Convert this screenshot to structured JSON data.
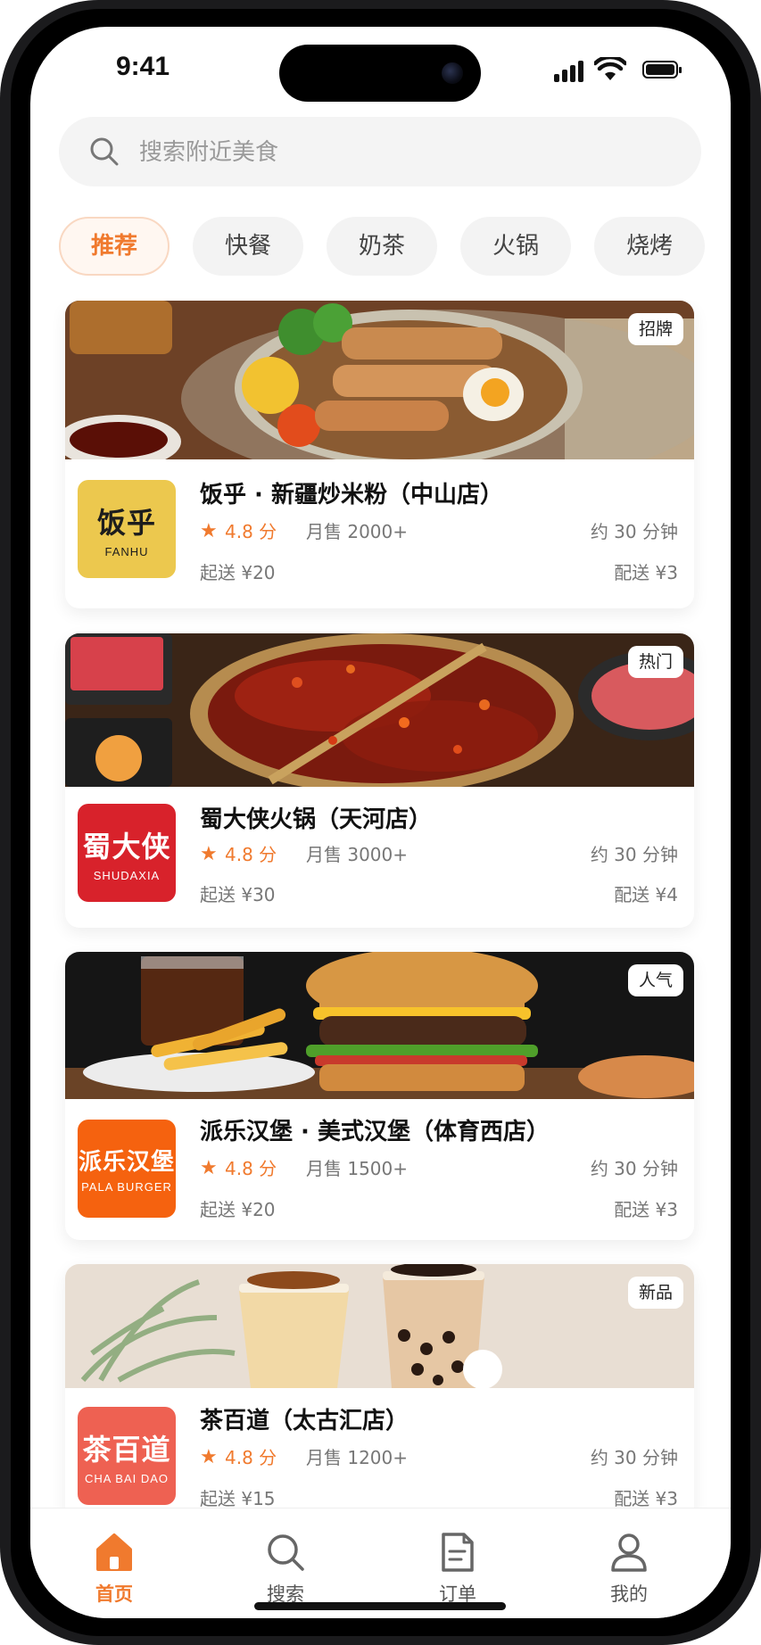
{
  "status": {
    "time": "9:41"
  },
  "search": {
    "placeholder": "搜索附近美食"
  },
  "categories": [
    {
      "label": "推荐",
      "active": true
    },
    {
      "label": "快餐"
    },
    {
      "label": "奶茶"
    },
    {
      "label": "火锅"
    },
    {
      "label": "烧烤"
    }
  ],
  "restaurants": [
    {
      "tag": "招牌",
      "logo_text": "饭乎",
      "logo_sub": "FANHU",
      "name": "饭乎 · 新疆炒米粉（中山店）",
      "rating": "4.8 分",
      "sales": "月售 2000+",
      "eta": "约 30 分钟",
      "min_order": "起送 ¥20",
      "delivery_fee": "配送 ¥3"
    },
    {
      "tag": "热门",
      "logo_text": "蜀大侠",
      "logo_sub": "SHUDAXIA",
      "name": "蜀大侠火锅（天河店）",
      "rating": "4.8 分",
      "sales": "月售 3000+",
      "eta": "约 30 分钟",
      "min_order": "起送 ¥30",
      "delivery_fee": "配送 ¥4"
    },
    {
      "tag": "人气",
      "logo_text": "派乐汉堡",
      "logo_sub": "PALA BURGER",
      "name": "派乐汉堡 · 美式汉堡（体育西店）",
      "rating": "4.8 分",
      "sales": "月售 1500+",
      "eta": "约 30 分钟",
      "min_order": "起送 ¥20",
      "delivery_fee": "配送 ¥3"
    },
    {
      "tag": "新品",
      "logo_text": "茶百道",
      "logo_sub": "CHA BAI DAO",
      "name": "茶百道（太古汇店）",
      "rating": "4.8 分",
      "sales": "月售 1200+",
      "eta": "约 30 分钟",
      "min_order": "起送 ¥15",
      "delivery_fee": "配送 ¥3"
    }
  ],
  "tabbar": [
    {
      "label": "首页",
      "icon": "home-icon",
      "active": true
    },
    {
      "label": "搜索",
      "icon": "search-icon"
    },
    {
      "label": "订单",
      "icon": "order-icon"
    },
    {
      "label": "我的",
      "icon": "profile-icon"
    }
  ],
  "colors": {
    "accent": "#f07a2e",
    "fanhu_logo": "#ecc84e",
    "shudaxia_logo": "#d8222b",
    "pala_logo": "#f5620f",
    "chabaidao_logo": "#ee6152"
  }
}
